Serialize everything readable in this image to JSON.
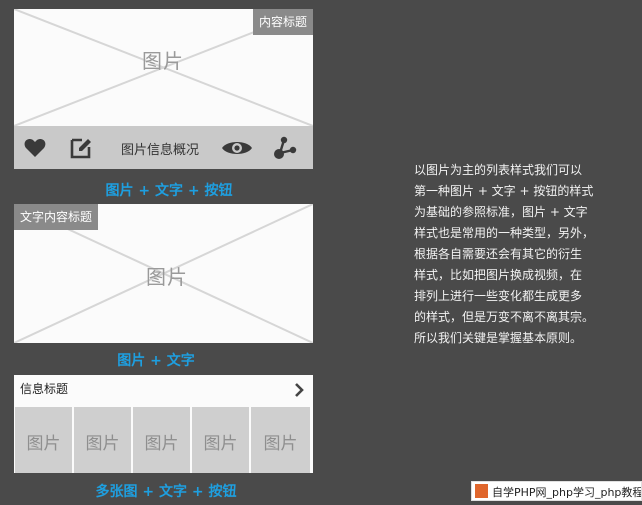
{
  "card1": {
    "placeholder": "图片",
    "tag": "内容标题",
    "toolbar_label": "图片信息概况",
    "icons": [
      "heart-icon",
      "edit-icon",
      "eye-icon",
      "share-icon"
    ],
    "caption": "图片 + 文字 + 按钮"
  },
  "card2": {
    "placeholder": "图片",
    "tag": "文字内容标题",
    "caption": "图片 + 文字"
  },
  "card3": {
    "title": "信息标题",
    "cells": [
      "图片",
      "图片",
      "图片",
      "图片",
      "图片"
    ],
    "caption": "多张图 + 文字 + 按钮"
  },
  "description": [
    "以图片为主的列表样式我们可以",
    "第一种图片 + 文字 + 按钮的样式",
    "为基础的参照标准，图片 + 文字",
    "样式也是常用的一种类型，另外，",
    "根据各自需要还会有其它的衍生",
    "样式，比如把图片换成视频，在",
    "排列上进行一些变化都生成更多",
    "的样式，但是万变不离不离其宗。",
    "所以我们关键是掌握基本原则。"
  ],
  "watermark": "自学PHP网_php学习_php教程",
  "colors": {
    "background": "#4a4a4a",
    "caption": "#1e9fe0",
    "toolbar": "#c9c9c9"
  }
}
